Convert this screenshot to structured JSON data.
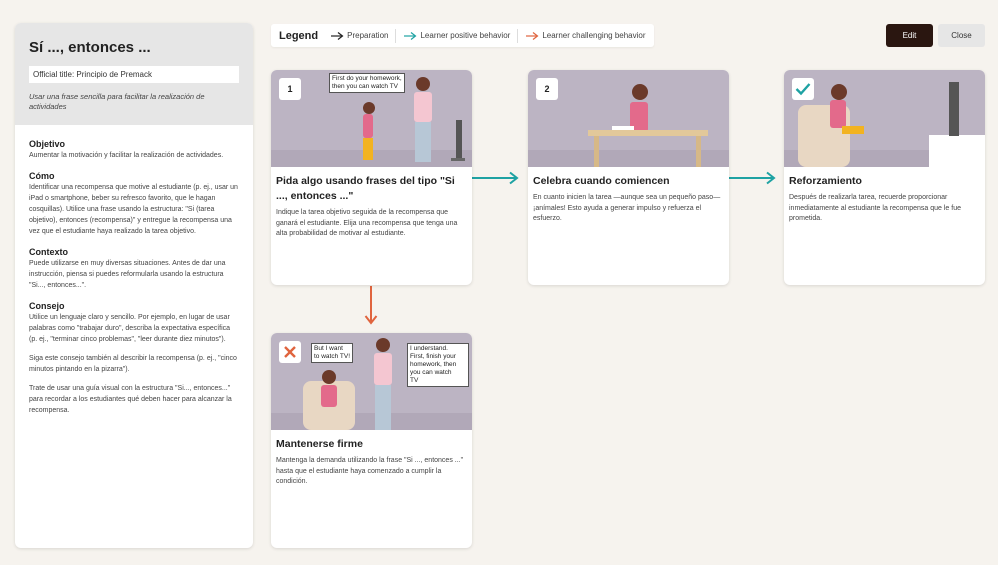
{
  "sidebar": {
    "title": "Sí ..., entonces ...",
    "official_title": "Official title: Principio de Premack",
    "subtitle": "Usar una frase sencilla para facilitar la realización de actividades",
    "sections": [
      {
        "title": "Objetivo",
        "text": "Aumentar la motivación y facilitar la realización de actividades."
      },
      {
        "title": "Cómo",
        "text": "Identificar una recompensa que motive al estudiante (p. ej., usar un iPad o smartphone, beber su refresco favorito, que le hagan cosquillas). Utilice una frase usando la estructura: \"Si (tarea objetivo), entonces (recompensa)\" y entregue la recompensa una vez que el estudiante haya realizado la tarea objetivo."
      },
      {
        "title": "Contexto",
        "text": "Puede utilizarse en muy diversas situaciones. Antes de dar una instrucción, piensa si puedes reformularla usando la estructura \"Si..., entonces...\"."
      },
      {
        "title": "Consejo",
        "text": "Utilice un lenguaje claro y sencillo. Por ejemplo, en lugar de usar palabras como \"trabajar duro\", describa la expectativa específica (p. ej., \"terminar cinco problemas\", \"leer durante diez minutos\").",
        "extra": [
          "Siga este consejo también al describir la recompensa (p. ej., \"cinco minutos pintando en la pizarra\").",
          "Trate de usar una guía visual con la estructura \"Si..., entonces...\" para recordar a los estudiantes qué deben hacer para alcanzar la recompensa."
        ]
      }
    ]
  },
  "legend": {
    "title": "Legend",
    "items": [
      "Preparation",
      "Learner positive behavior",
      "Learner challenging behavior"
    ]
  },
  "buttons": {
    "edit": "Edit",
    "close": "Close"
  },
  "colors": {
    "preparation": "#222222",
    "positive": "#1ea2a3",
    "challenging": "#e0643e",
    "edit_bg": "#2a1610"
  },
  "cards": [
    {
      "badge": "1",
      "title": "Pida algo usando frases del tipo \"Si ..., entonces ...\"",
      "text": "Indique la tarea objetivo seguida de la recompensa que ganará el estudiante. Elija una recompensa que tenga una alta probabilidad de motivar al estudiante.",
      "bubble": [
        "First do your homework,",
        "then you can watch TV"
      ]
    },
    {
      "badge": "2",
      "title": "Celebra cuando comiencen",
      "text": "En cuanto inicien la tarea —aunque sea un pequeño paso— ¡anímales! Esto ayuda a generar impulso y refuerza el esfuerzo."
    },
    {
      "badge_icon": "check-icon",
      "title": "Reforzamiento",
      "text": "Después de realizarla tarea, recuerde proporcionar inmediatamente al estudiante la recompensa que le fue prometida."
    },
    {
      "badge_icon": "cross-icon",
      "title": "Mantenerse firme",
      "text": "Mantenga la demanda utilizando la frase \"Si ..., entonces ...\" hasta que el estudiante haya comenzado a cumplir la condición.",
      "bubble_left": [
        "But I want",
        "to watch TV!"
      ],
      "bubble_right": [
        "I understand.",
        "First, finish your",
        "homework, then",
        "you can watch",
        "TV"
      ]
    }
  ]
}
